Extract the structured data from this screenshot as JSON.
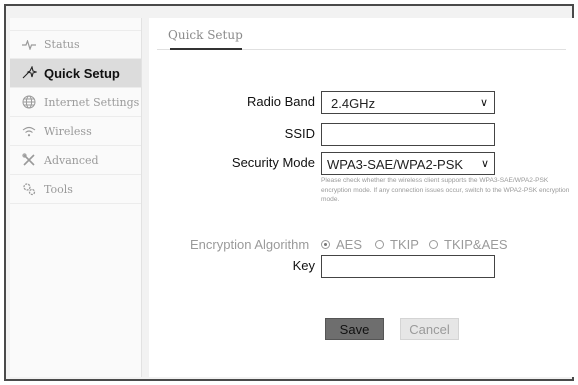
{
  "sidebar": {
    "items": [
      {
        "label": "Status",
        "icon": "pulse-icon",
        "active": false
      },
      {
        "label": "Quick Setup",
        "icon": "sparkle-icon",
        "active": true
      },
      {
        "label": "Internet Settings",
        "icon": "globe-icon",
        "active": false
      },
      {
        "label": "Wireless",
        "icon": "wifi-icon",
        "active": false
      },
      {
        "label": "Advanced",
        "icon": "tools-cross-icon",
        "active": false
      },
      {
        "label": "Tools",
        "icon": "gears-icon",
        "active": false
      }
    ]
  },
  "main": {
    "tab_title": "Quick Setup",
    "radio_band": {
      "label": "Radio Band",
      "value": "2.4GHz"
    },
    "ssid": {
      "label": "SSID",
      "value": ""
    },
    "security_mode": {
      "label": "Security Mode",
      "value": "WPA3-SAE/WPA2-PSK"
    },
    "hint": "Please check whether the wireless client supports the WPA3-SAE/WPA2-PSK encryption mode. If any connection issues occur, switch to the WPA2-PSK encryption mode.",
    "encryption": {
      "label": "Encryption Algorithm",
      "options": [
        {
          "label": "AES",
          "selected": true
        },
        {
          "label": "TKIP",
          "selected": false
        },
        {
          "label": "TKIP&AES",
          "selected": false
        }
      ]
    },
    "key": {
      "label": "Key",
      "value": ""
    },
    "buttons": {
      "save": "Save",
      "cancel": "Cancel"
    }
  },
  "colors": {
    "save_bg": "#6e6e6e",
    "active_nav_bg": "#dcdcdc",
    "disabled_text": "#9a9a9a"
  }
}
